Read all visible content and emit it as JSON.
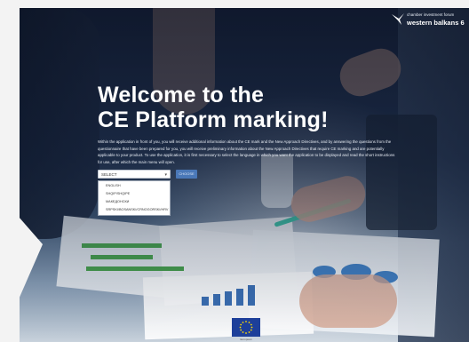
{
  "brand": {
    "subtitle": "chamber investment forum",
    "name": "western balkans 6",
    "icon": "bird-logo-icon"
  },
  "hero": {
    "title_line1": "Welcome to the",
    "title_line2": "CE Platform marking!",
    "intro": "Within the application in front of you, you will receive additional information about the CE mark and the New Approach Directives, and by answering the questions from the questionnaire that have been prepared for you, you will receive preliminary information about the New Approach Directives that require CE marking and are potentially applicable to your product. To use the application, it is first necessary to select the language in which you want the application to be displayed and read the short instructions for use, after which the main menu will open."
  },
  "language": {
    "selected": "SELECT",
    "button": "CHOOSE",
    "options": [
      "ENGLISH",
      "SHQIP/SHQIPE",
      "МАКЕДОНСКИ",
      "SRPSKI/BOSANSKI/CRNOGORSKI/HRV"
    ]
  },
  "footer": {
    "eu_caption": "European"
  },
  "colors": {
    "accent": "#4a78b8",
    "overlay": "#16213a",
    "eu_blue": "#1d3f9a",
    "eu_star": "#ffdd00"
  }
}
